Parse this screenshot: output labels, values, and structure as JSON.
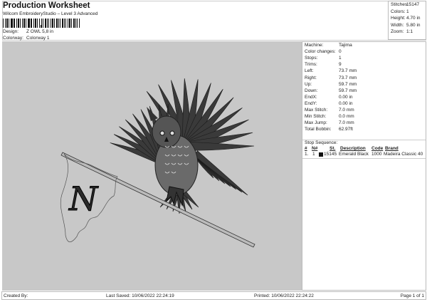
{
  "header": {
    "title": "Production Worksheet",
    "subtitle": "Wilcom EmbroideryStudio – Level 3 Advanced",
    "design_label": "Design:",
    "design_value": "Z OWL 5,8 in",
    "colorway_label": "Colorway:",
    "colorway_value": "Colorway 1"
  },
  "stats": [
    {
      "k": "Stitches:",
      "v": "15147"
    },
    {
      "k": "Colors:",
      "v": "1"
    },
    {
      "k": "Height:",
      "v": "4.70 in"
    },
    {
      "k": "Width:",
      "v": "5.80 in"
    },
    {
      "k": "Zoom:",
      "v": "1:1"
    }
  ],
  "details": [
    {
      "k": "Machine:",
      "v": "Tajima"
    },
    {
      "k": "Color changes:",
      "v": "0"
    },
    {
      "k": "Stops:",
      "v": "1"
    },
    {
      "k": "Trims:",
      "v": "9"
    },
    {
      "k": "Left:",
      "v": "73.7 mm"
    },
    {
      "k": "Right:",
      "v": "73.7 mm"
    },
    {
      "k": "Up:",
      "v": "59.7 mm"
    },
    {
      "k": "Down:",
      "v": "59.7 mm"
    },
    {
      "k": "EndX:",
      "v": "0.00 in"
    },
    {
      "k": "EndY:",
      "v": "0.00 in"
    },
    {
      "k": "Max Stitch:",
      "v": "7.0 mm"
    },
    {
      "k": "Min Stitch:",
      "v": "0.0 mm"
    },
    {
      "k": "Max Jump:",
      "v": "7.0 mm"
    },
    {
      "k": "Total Bobbin:",
      "v": "62.97ft"
    }
  ],
  "stop_sequence": {
    "label": "Stop Sequence:",
    "headers": [
      "#",
      "N#",
      "St.",
      "Description",
      "Code",
      "Brand"
    ],
    "rows": [
      {
        "num": "1.",
        "n": "1",
        "swatch": "#111111",
        "st": "15145",
        "desc": "Emerald Black",
        "code": "1000",
        "brand": "Madeira Classic 40"
      }
    ]
  },
  "footer": {
    "created": "Created By:",
    "saved": "Last Saved: 10/06/2022 22:24:19",
    "printed": "Printed: 10/06/2022 22:24:22",
    "page": "Page 1 of 1"
  },
  "design_letter": "N"
}
